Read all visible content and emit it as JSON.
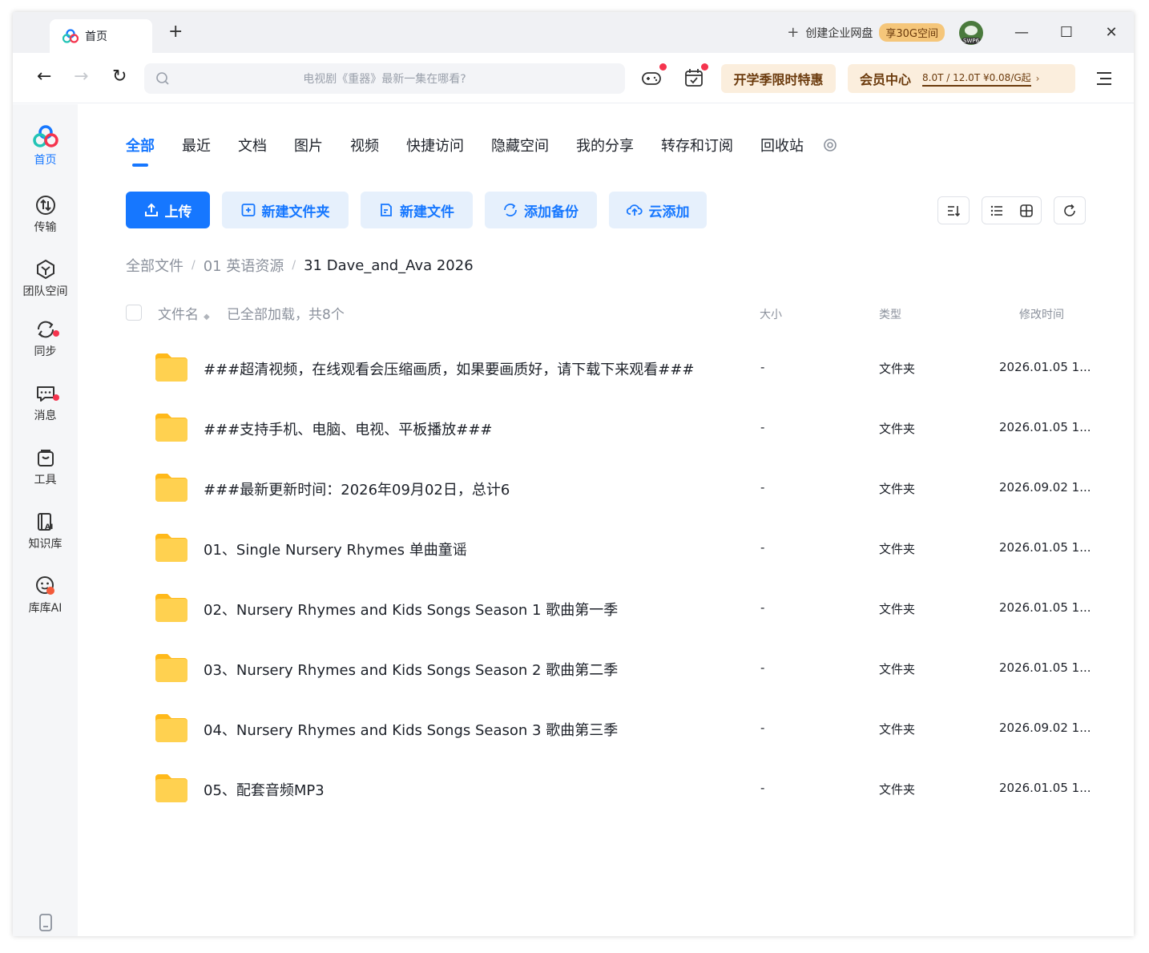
{
  "titlebar": {
    "tab_label": "首页",
    "new_tab": "+",
    "create_enterprise": "创建企业网盘",
    "space_badge": "享30G空间",
    "avatar_badge": "SWP6",
    "minimize": "—",
    "maximize": "☐",
    "close": "✕"
  },
  "navbar": {
    "back": "←",
    "forward": "→",
    "refresh": "↻",
    "search_placeholder": "电视剧《重器》最新一集在哪看?",
    "promo": "开学季限时特惠",
    "vip_title": "会员中心",
    "vip_info": "8.0T / 12.0T   ¥0.08/G起",
    "vip_chevron": "›"
  },
  "sidebar": {
    "items": [
      {
        "label": "首页",
        "icon": "home-logo-icon"
      },
      {
        "label": "传输",
        "icon": "transfer-icon"
      },
      {
        "label": "团队空间",
        "icon": "team-space-icon"
      },
      {
        "label": "同步",
        "icon": "sync-icon"
      },
      {
        "label": "消息",
        "icon": "message-icon"
      },
      {
        "label": "工具",
        "icon": "tools-icon"
      },
      {
        "label": "知识库",
        "icon": "knowledge-base-icon"
      },
      {
        "label": "库库AI",
        "icon": "kuku-ai-icon"
      }
    ]
  },
  "tabs": [
    "全部",
    "最近",
    "文档",
    "图片",
    "视频",
    "快捷访问",
    "隐藏空间",
    "我的分享",
    "转存和订阅",
    "回收站"
  ],
  "actions": {
    "upload": "上传",
    "new_folder": "新建文件夹",
    "new_file": "新建文件",
    "add_backup": "添加备份",
    "cloud_add": "云添加"
  },
  "breadcrumb": {
    "items": [
      "全部文件",
      "01 英语资源",
      "31 Dave_and_Ava 2026"
    ],
    "separator": "/"
  },
  "table": {
    "header": {
      "name": "文件名",
      "loaded": "已全部加载，共8个",
      "size": "大小",
      "type": "类型",
      "mtime": "修改时间"
    },
    "rows": [
      {
        "name": "###超清视频，在线观看会压缩画质，如果要画质好，请下载下来观看###",
        "size": "-",
        "type": "文件夹",
        "mtime": "2026.01.05 1..."
      },
      {
        "name": "###支持手机、电脑、电视、平板播放###",
        "size": "-",
        "type": "文件夹",
        "mtime": "2026.01.05 1..."
      },
      {
        "name": "###最新更新时间：2026年09月02日，总计6",
        "size": "-",
        "type": "文件夹",
        "mtime": "2026.09.02 1..."
      },
      {
        "name": "01、Single Nursery Rhymes 单曲童谣",
        "size": "-",
        "type": "文件夹",
        "mtime": "2026.01.05 1..."
      },
      {
        "name": "02、Nursery Rhymes and Kids Songs Season 1 歌曲第一季",
        "size": "-",
        "type": "文件夹",
        "mtime": "2026.01.05 1..."
      },
      {
        "name": "03、Nursery Rhymes and Kids Songs Season 2 歌曲第二季",
        "size": "-",
        "type": "文件夹",
        "mtime": "2026.01.05 1..."
      },
      {
        "name": "04、Nursery Rhymes and Kids Songs Season 3 歌曲第三季",
        "size": "-",
        "type": "文件夹",
        "mtime": "2026.09.02 1..."
      },
      {
        "name": "05、配套音频MP3",
        "size": "-",
        "type": "文件夹",
        "mtime": "2026.01.05 1..."
      }
    ]
  },
  "colors": {
    "accent": "#1677ff",
    "accent_light": "#e6f0fc",
    "promo_bg": "#fbeedd",
    "promo_text": "#6b3a0c",
    "folder": "#ffc83d",
    "notification_dot": "#f5344e"
  }
}
